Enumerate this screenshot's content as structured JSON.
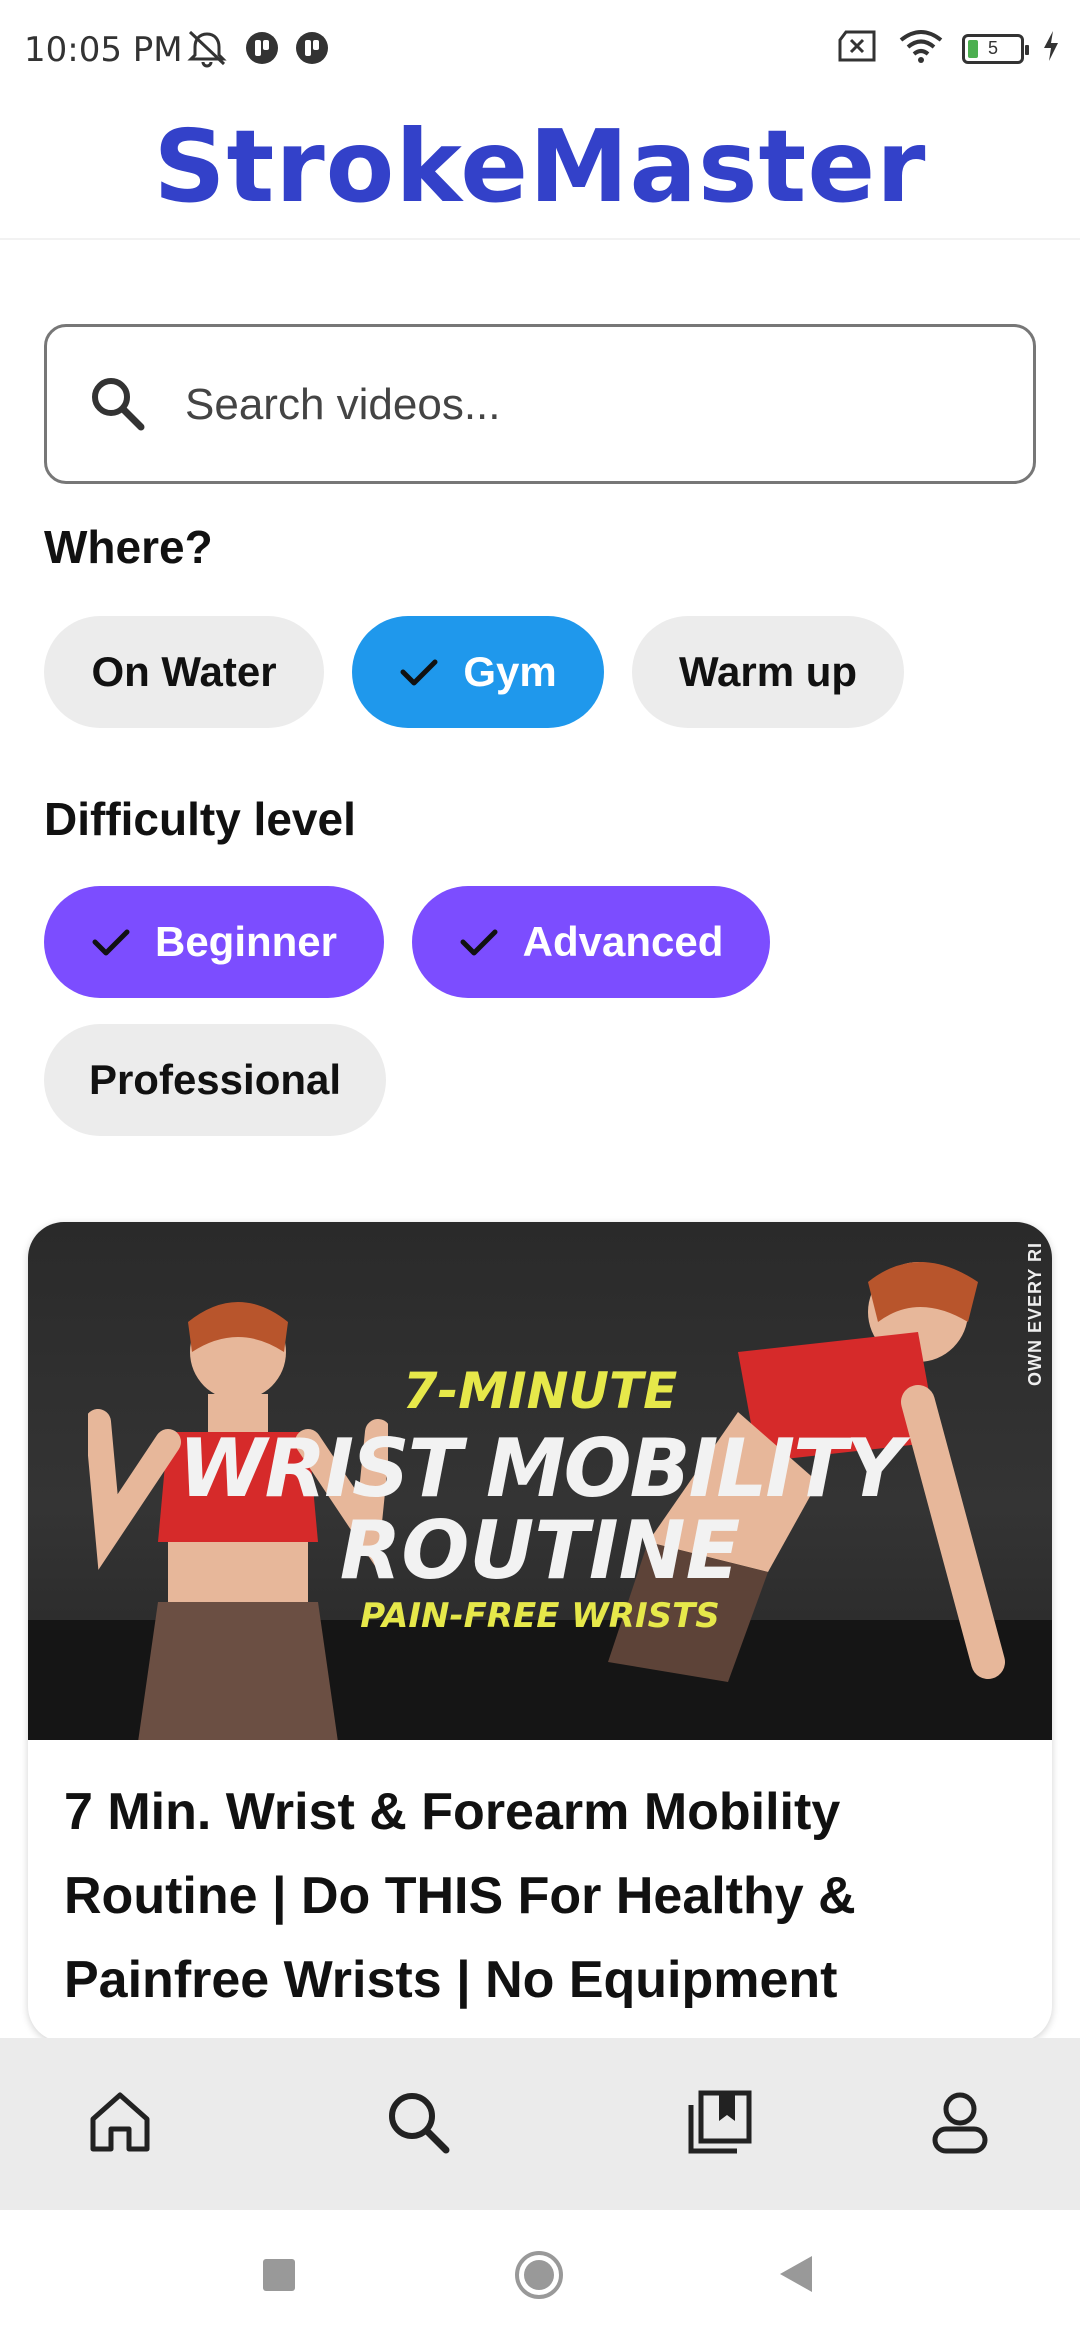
{
  "status_bar": {
    "time": "10:05 PM",
    "battery_level": "5",
    "icons": [
      "mute-icon",
      "app-notification-icon",
      "app-notification-icon",
      "sim-error-icon",
      "wifi-icon",
      "battery-icon",
      "charging-icon"
    ]
  },
  "app": {
    "title": "StrokeMaster"
  },
  "search": {
    "placeholder": "Search videos..."
  },
  "filters": {
    "where": {
      "label": "Where?",
      "options": [
        {
          "label": "On Water",
          "selected": false
        },
        {
          "label": "Gym",
          "selected": true
        },
        {
          "label": "Warm up",
          "selected": false
        }
      ]
    },
    "difficulty": {
      "label": "Difficulty level",
      "options": [
        {
          "label": "Beginner",
          "selected": true
        },
        {
          "label": "Advanced",
          "selected": true
        },
        {
          "label": "Professional",
          "selected": false
        }
      ]
    }
  },
  "video": {
    "thumbnail_text": {
      "line1": "7-MINUTE",
      "line2": "WRIST MOBILITY",
      "line3": "ROUTINE",
      "line4": "PAIN-FREE WRISTS",
      "side": "OWN EVERY RI"
    },
    "title": "7 Min. Wrist & Forearm Mobility Routine | Do THIS For Healthy  & Painfree Wrists | No Equipment"
  },
  "bottom_nav": [
    "home-icon",
    "search-icon",
    "bookmarks-icon",
    "profile-icon"
  ],
  "system_nav": [
    "recents-icon",
    "home-circle-icon",
    "back-icon"
  ],
  "colors": {
    "brand": "#3341c9",
    "chip_blue": "#1f98ec",
    "chip_purple": "#7c4dff",
    "chip_off": "#ececec"
  }
}
